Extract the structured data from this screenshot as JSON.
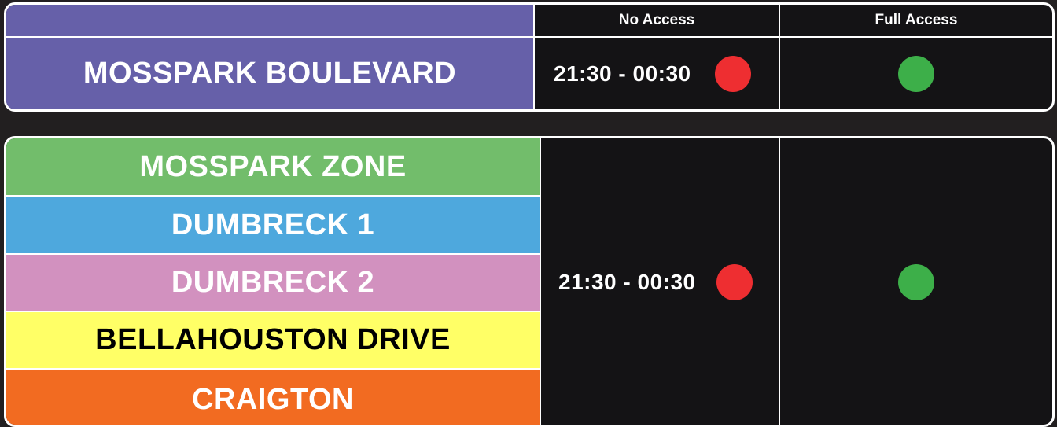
{
  "header": {
    "no_access_label": "No Access",
    "full_access_label": "Full Access"
  },
  "top_row": {
    "zone_name": "MOSSPARK BOULEVARD",
    "zone_color": "#6660a9",
    "no_access_time": "21:30 - 00:30",
    "no_access_indicator": "red-dot",
    "full_access_indicator": "green-dot"
  },
  "group": {
    "zones": [
      {
        "name": "MOSSPARK ZONE",
        "color": "#72bd6b",
        "text_color": "#ffffff"
      },
      {
        "name": "DUMBRECK 1",
        "color": "#4ea8dd",
        "text_color": "#ffffff"
      },
      {
        "name": "DUMBRECK 2",
        "color": "#d291bf",
        "text_color": "#ffffff"
      },
      {
        "name": "BELLAHOUSTON DRIVE",
        "color": "#ffff66",
        "text_color": "#000000"
      },
      {
        "name": "CRAIGTON",
        "color": "#f26b21",
        "text_color": "#ffffff"
      }
    ],
    "no_access_time": "21:30 - 00:30",
    "no_access_indicator": "red-dot",
    "full_access_indicator": "green-dot"
  },
  "colors": {
    "red": "#ee2e31",
    "green": "#3daf49",
    "background": "#221f20",
    "cell_dark": "#141315"
  }
}
